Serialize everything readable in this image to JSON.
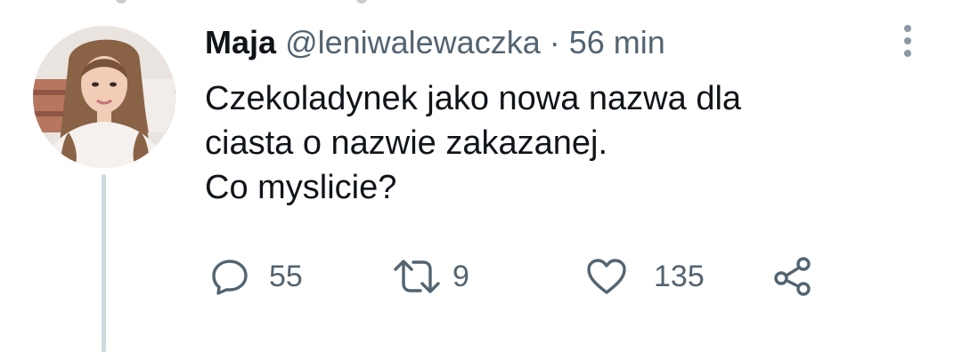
{
  "tweet": {
    "author_name": "Maja",
    "handle": "@leniwalewaczka",
    "separator": "·",
    "time": "56 min",
    "text": "Czekoladynek jako nowa nazwa dla\nciasta o nazwie zakazanej.\nCo myslicie?",
    "avatar_icon": "profile-photo",
    "more_icon": "vertical-dots-icon"
  },
  "actions": {
    "reply": {
      "icon": "reply-bubble-icon",
      "count": "55"
    },
    "retweet": {
      "icon": "retweet-icon",
      "count": "9"
    },
    "like": {
      "icon": "heart-icon",
      "count": "135"
    },
    "share": {
      "icon": "share-icon"
    }
  },
  "colors": {
    "text_primary": "#0f1419",
    "text_secondary": "#536471",
    "thread_line": "#cfd9de"
  }
}
